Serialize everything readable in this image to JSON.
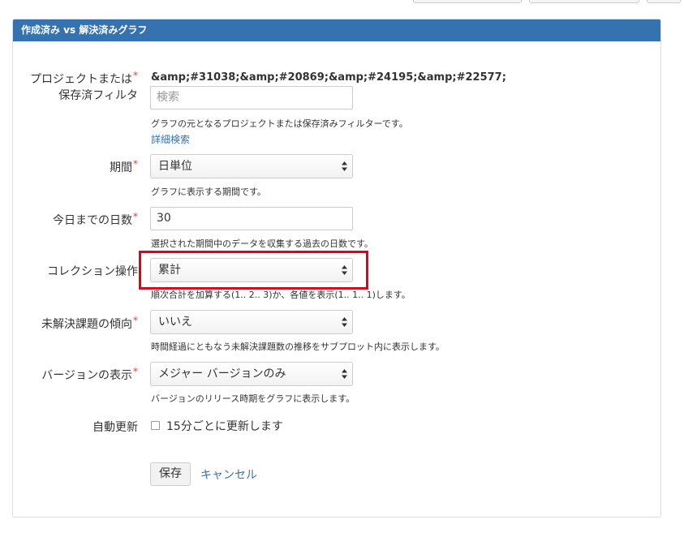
{
  "panel": {
    "title": "作成済み vs 解決済みグラフ"
  },
  "project_filter": {
    "label_line1": "プロジェクトまたは",
    "label_line2": "保存済フィルタ",
    "selected_value": "&amp;#31038;&amp;#20869;&amp;#24195;&amp;#22577;",
    "search_placeholder": "検索",
    "description": "グラフの元となるプロジェクトまたは保存済みフィルターです。",
    "advanced_link": "詳細検索"
  },
  "period": {
    "label": "期間",
    "value": "日単位",
    "description": "グラフに表示する期間です。"
  },
  "days": {
    "label": "今日までの日数",
    "value": "30",
    "description": "選択された期間中のデータを収集する過去の日数です。"
  },
  "collection": {
    "label": "コレクション操作",
    "value": "累計",
    "description": "順次合計を加算する(1.. 2.. 3)か、各値を表示(1.. 1.. 1)します。"
  },
  "unresolved_trend": {
    "label": "未解決課題の傾向",
    "value": "いいえ",
    "description": "時間経過にともなう未解決課題数の推移をサブプロット内に表示します。"
  },
  "versions": {
    "label": "バージョンの表示",
    "value": "メジャー バージョンのみ",
    "description": "バージョンのリリース時期をグラフに表示します。"
  },
  "auto_refresh": {
    "label": "自動更新",
    "checkbox_label": "15分ごとに更新します",
    "checked": false
  },
  "actions": {
    "save": "保存",
    "cancel": "キャンセル"
  },
  "required_mark": "*",
  "colors": {
    "header": "#3572b0",
    "required": "#d04437",
    "highlight": "#e3001b",
    "link": "#3572b0"
  }
}
